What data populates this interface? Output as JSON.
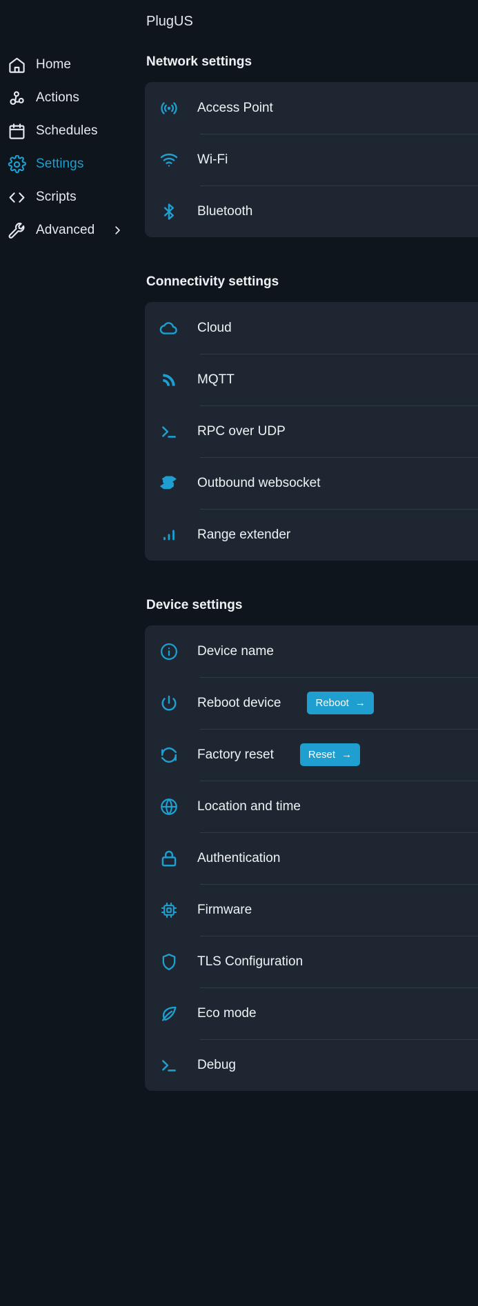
{
  "sidebar": {
    "items": [
      {
        "label": "Home",
        "icon": "home-icon",
        "active": false,
        "chevron": false
      },
      {
        "label": "Actions",
        "icon": "actions-icon",
        "active": false,
        "chevron": false
      },
      {
        "label": "Schedules",
        "icon": "calendar-icon",
        "active": false,
        "chevron": false
      },
      {
        "label": "Settings",
        "icon": "gear-icon",
        "active": true,
        "chevron": false
      },
      {
        "label": "Scripts",
        "icon": "code-icon",
        "active": false,
        "chevron": false
      },
      {
        "label": "Advanced",
        "icon": "wrench-icon",
        "active": false,
        "chevron": true
      }
    ]
  },
  "header": {
    "device_title": "PlugUS"
  },
  "sections": [
    {
      "title": "Network settings",
      "items": [
        {
          "label": "Access Point",
          "icon": "access-point-icon"
        },
        {
          "label": "Wi-Fi",
          "icon": "wifi-icon"
        },
        {
          "label": "Bluetooth",
          "icon": "bluetooth-icon"
        }
      ]
    },
    {
      "title": "Connectivity settings",
      "items": [
        {
          "label": "Cloud",
          "icon": "cloud-icon"
        },
        {
          "label": "MQTT",
          "icon": "mqtt-icon"
        },
        {
          "label": "RPC over UDP",
          "icon": "terminal-icon"
        },
        {
          "label": "Outbound websocket",
          "icon": "websocket-icon"
        },
        {
          "label": "Range extender",
          "icon": "signal-bars-icon"
        }
      ]
    },
    {
      "title": "Device settings",
      "items": [
        {
          "label": "Device name",
          "icon": "info-icon"
        },
        {
          "label": "Reboot device",
          "icon": "power-icon",
          "button": {
            "label": "Reboot",
            "arrow": "→"
          }
        },
        {
          "label": "Factory reset",
          "icon": "refresh-icon",
          "button": {
            "label": "Reset",
            "arrow": "→"
          }
        },
        {
          "label": "Location and time",
          "icon": "globe-icon"
        },
        {
          "label": "Authentication",
          "icon": "lock-icon"
        },
        {
          "label": "Firmware",
          "icon": "chip-icon"
        },
        {
          "label": "TLS Configuration",
          "icon": "shield-icon"
        },
        {
          "label": "Eco mode",
          "icon": "leaf-icon"
        },
        {
          "label": "Debug",
          "icon": "terminal-icon"
        }
      ]
    }
  ],
  "colors": {
    "accent": "#1e9fd0",
    "background": "#0f151c",
    "card_background": "#1e2731",
    "text": "#eef2f5",
    "divider": "#2f3b46"
  }
}
